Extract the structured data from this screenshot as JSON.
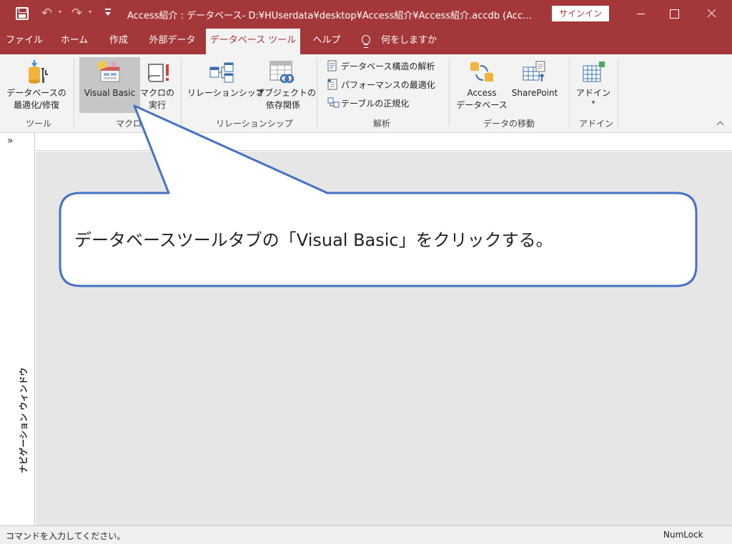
{
  "window": {
    "title": "Access紹介 : データベース- D:¥HUserdata¥desktop¥Access紹介¥Access紹介.accdb (Acc…",
    "signin_label": "サインイン",
    "accent": "#a4373a"
  },
  "qat": {
    "save_icon": "save-icon",
    "undo_glyph": "↶",
    "redo_glyph": "↷",
    "dropdown_glyph": "▾"
  },
  "tabs": [
    {
      "label": "ファイル"
    },
    {
      "label": "ホーム"
    },
    {
      "label": "作成"
    },
    {
      "label": "外部データ"
    },
    {
      "label": "データベース ツール",
      "active": true
    },
    {
      "label": "ヘルプ"
    }
  ],
  "tell_me": "何をしますか",
  "ribbon": {
    "groups": {
      "tools": "ツール",
      "macro": "マクロ",
      "relationships": "リレーションシップ",
      "analyze": "解析",
      "move_data": "データの移動",
      "addins": "アドイン"
    },
    "buttons": {
      "compact_repair_1": "データベースの",
      "compact_repair_2": "最適化/修復",
      "visual_basic": "Visual Basic",
      "run_macro_1": "マクロの",
      "run_macro_2": "実行",
      "relationships": "リレーションシップ",
      "object_dep_1": "オブジェクトの",
      "object_dep_2": "依存関係",
      "db_documenter": "データベース構造の解析",
      "analyze_perf": "パフォーマンスの最適化",
      "analyze_table": "テーブルの正規化",
      "access_db_1": "Access",
      "access_db_2": "データベース",
      "sharepoint": "SharePoint",
      "addins": "アドイン",
      "addins_drop": "▾"
    }
  },
  "nav_pane": {
    "chevron": "»",
    "label": "ナビゲーション ウィンドウ"
  },
  "callout": {
    "text": "データベースツールタブの「Visual Basic」をクリックする。",
    "border_color": "#4472c4"
  },
  "status": {
    "left": "コマンドを入力してください。",
    "right": "NumLock"
  }
}
